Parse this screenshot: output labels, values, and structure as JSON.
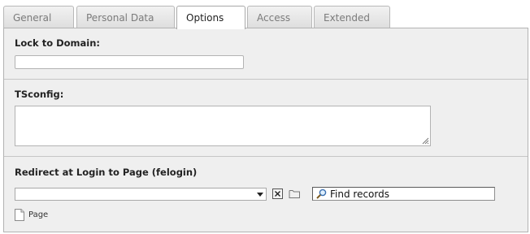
{
  "tabs": [
    {
      "label": "General",
      "active": false
    },
    {
      "label": "Personal Data",
      "active": false
    },
    {
      "label": "Options",
      "active": true
    },
    {
      "label": "Access",
      "active": false
    },
    {
      "label": "Extended",
      "active": false
    }
  ],
  "fields": {
    "lock_to_domain": {
      "label": "Lock to Domain:",
      "value": ""
    },
    "tsconfig": {
      "label": "TSconfig:",
      "value": ""
    },
    "redirect": {
      "label": "Redirect at Login to Page (felogin)",
      "selected": "",
      "find_placeholder": "Find records",
      "record_type": "Page"
    }
  },
  "icons": {
    "remove": "remove-x-icon",
    "browse": "folder-icon",
    "search": "magnifier-icon",
    "record": "page-icon"
  },
  "colors": {
    "panel_bg": "#efefef",
    "active_tab_bg": "#ffffff",
    "inactive_tab_text": "#7b7b7b"
  }
}
